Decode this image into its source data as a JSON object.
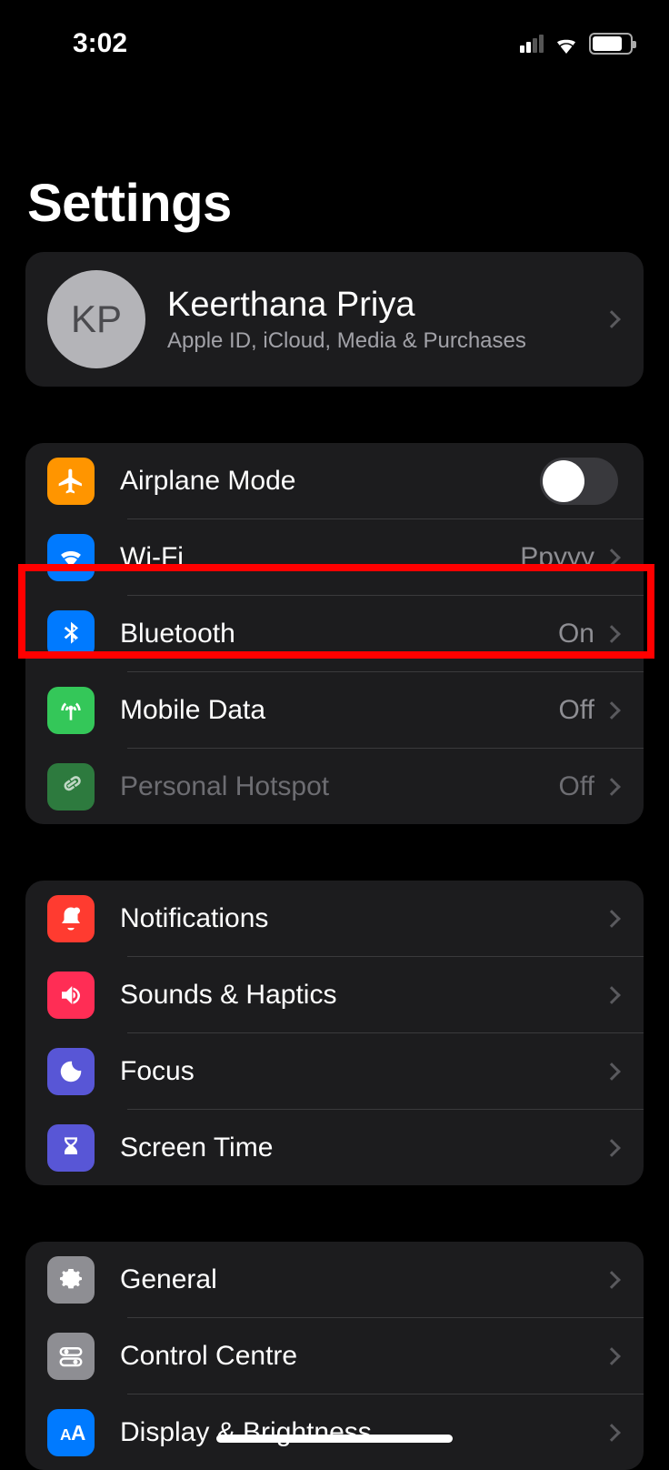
{
  "status": {
    "time": "3:02"
  },
  "page": {
    "title": "Settings"
  },
  "profile": {
    "initials": "KP",
    "name": "Keerthana Priya",
    "subtitle": "Apple ID, iCloud, Media & Purchases"
  },
  "group_conn": {
    "airplane": {
      "label": "Airplane Mode",
      "toggle": false
    },
    "wifi": {
      "label": "Wi-Fi",
      "value": "Ppyyy"
    },
    "bluetooth": {
      "label": "Bluetooth",
      "value": "On"
    },
    "mobile": {
      "label": "Mobile Data",
      "value": "Off"
    },
    "hotspot": {
      "label": "Personal Hotspot",
      "value": "Off"
    }
  },
  "group_notif": {
    "notifications": {
      "label": "Notifications"
    },
    "sounds": {
      "label": "Sounds & Haptics"
    },
    "focus": {
      "label": "Focus"
    },
    "screentime": {
      "label": "Screen Time"
    }
  },
  "group_gen": {
    "general": {
      "label": "General"
    },
    "control": {
      "label": "Control Centre"
    },
    "display": {
      "label": "Display & Brightness"
    }
  },
  "icons": {
    "airplane": "airplane-icon",
    "wifi": "wifi-icon",
    "bluetooth": "bluetooth-icon",
    "mobile": "antenna-icon",
    "hotspot": "link-icon",
    "notifications": "bell-icon",
    "sounds": "speaker-icon",
    "focus": "moon-icon",
    "screentime": "hourglass-icon",
    "general": "gear-icon",
    "control": "sliders-icon",
    "display": "text-size-icon"
  },
  "colors": {
    "orange": "#ff9500",
    "blue": "#007aff",
    "green": "#34c759",
    "darkgreen": "#2d7a3e",
    "red": "#ff3b30",
    "pink": "#ff2d55",
    "indigo": "#5856d6",
    "grey": "#8e8e93"
  }
}
